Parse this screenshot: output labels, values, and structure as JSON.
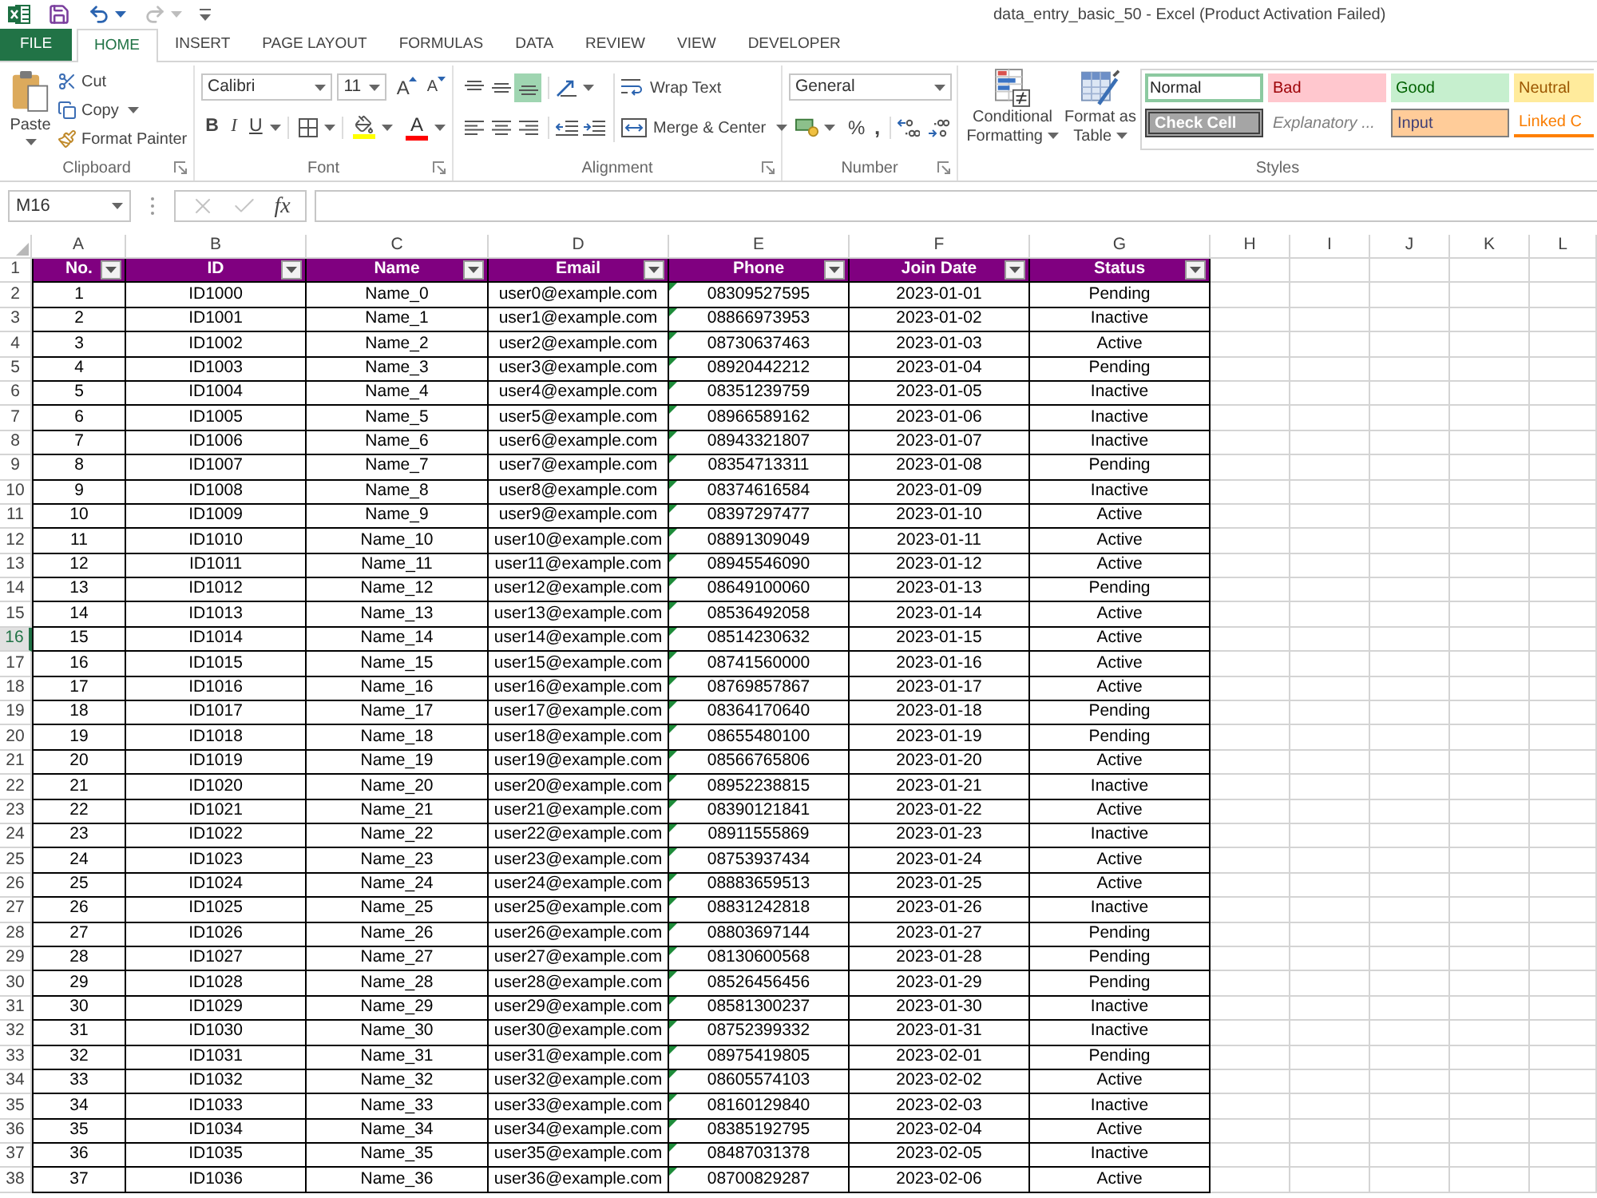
{
  "window": {
    "title": "data_entry_basic_50 - Excel (Product Activation Failed)"
  },
  "quick_access": [
    {
      "kind": "save",
      "disabled": false
    },
    {
      "kind": "undo",
      "disabled": false
    },
    {
      "kind": "redo",
      "disabled": true
    },
    {
      "kind": "customize",
      "disabled": false
    }
  ],
  "tabs": [
    {
      "label": "FILE",
      "kind": "file",
      "selected": false
    },
    {
      "label": "HOME",
      "kind": "tab",
      "selected": true
    },
    {
      "label": "INSERT",
      "kind": "tab",
      "selected": false
    },
    {
      "label": "PAGE LAYOUT",
      "kind": "tab",
      "selected": false
    },
    {
      "label": "FORMULAS",
      "kind": "tab",
      "selected": false
    },
    {
      "label": "DATA",
      "kind": "tab",
      "selected": false
    },
    {
      "label": "REVIEW",
      "kind": "tab",
      "selected": false
    },
    {
      "label": "VIEW",
      "kind": "tab",
      "selected": false
    },
    {
      "label": "DEVELOPER",
      "kind": "tab",
      "selected": false
    }
  ],
  "ribbon": {
    "clipboard": {
      "label": "Clipboard",
      "launcher": true,
      "paste": "Paste",
      "items": [
        {
          "label": "Cut",
          "kind": "cut",
          "dropdown": false
        },
        {
          "label": "Copy",
          "kind": "copy",
          "dropdown": true
        },
        {
          "label": "Format Painter",
          "kind": "painter",
          "dropdown": false
        }
      ]
    },
    "font": {
      "label": "Font",
      "launcher": true,
      "name": "Calibri",
      "size": "11",
      "grow": "A",
      "shrink": "A",
      "styles": [
        {
          "label": "B",
          "kind": "bold",
          "dropdown": false
        },
        {
          "label": "I",
          "kind": "italic",
          "dropdown": false
        },
        {
          "label": "U",
          "kind": "underline",
          "dropdown": true
        }
      ],
      "font_color": "A"
    },
    "alignment": {
      "label": "Alignment",
      "launcher": true,
      "vertical": [
        {
          "kind": "top",
          "selected": false
        },
        {
          "kind": "middle",
          "selected": false
        },
        {
          "kind": "bottom",
          "selected": true
        }
      ],
      "wrap_text": "Wrap Text",
      "merge": "Merge & Center"
    },
    "number": {
      "label": "Number",
      "launcher": true,
      "format": "General",
      "percent": "%",
      "comma": ","
    },
    "styles": {
      "label": "Styles",
      "launcher": false,
      "conditional": "Conditional Formatting",
      "format_table": "Format as Table",
      "gallery": [
        {
          "label": "Normal",
          "kind": "normal",
          "selected": true
        },
        {
          "label": "Bad",
          "kind": "bad",
          "selected": false
        },
        {
          "label": "Good",
          "kind": "good",
          "selected": false
        },
        {
          "label": "Neutral",
          "kind": "neutral",
          "selected": false
        },
        {
          "label": "Check Cell",
          "kind": "check",
          "selected": false
        },
        {
          "label": "Explanatory ...",
          "kind": "explanatory",
          "selected": false
        },
        {
          "label": "Input",
          "kind": "input",
          "selected": false
        },
        {
          "label": "Linked C",
          "kind": "linked",
          "selected": false
        }
      ]
    }
  },
  "formula_bar": {
    "name_box": "M16",
    "function": "fx",
    "buttons_disabled": true
  },
  "sheet": {
    "column_letters": [
      "A",
      "B",
      "C",
      "D",
      "E",
      "F",
      "G",
      "H",
      "I",
      "J",
      "K",
      "L"
    ],
    "row_numbers": [
      {
        "label": "1",
        "selected": false
      },
      {
        "label": "2",
        "selected": false
      },
      {
        "label": "3",
        "selected": false
      },
      {
        "label": "4",
        "selected": false
      },
      {
        "label": "5",
        "selected": false
      },
      {
        "label": "6",
        "selected": false
      },
      {
        "label": "7",
        "selected": false
      },
      {
        "label": "8",
        "selected": false
      },
      {
        "label": "9",
        "selected": false
      },
      {
        "label": "10",
        "selected": false
      },
      {
        "label": "11",
        "selected": false
      },
      {
        "label": "12",
        "selected": false
      },
      {
        "label": "13",
        "selected": false
      },
      {
        "label": "14",
        "selected": false
      },
      {
        "label": "15",
        "selected": false
      },
      {
        "label": "16",
        "selected": true
      },
      {
        "label": "17",
        "selected": false
      },
      {
        "label": "18",
        "selected": false
      },
      {
        "label": "19",
        "selected": false
      },
      {
        "label": "20",
        "selected": false
      },
      {
        "label": "21",
        "selected": false
      },
      {
        "label": "22",
        "selected": false
      },
      {
        "label": "23",
        "selected": false
      },
      {
        "label": "24",
        "selected": false
      },
      {
        "label": "25",
        "selected": false
      },
      {
        "label": "26",
        "selected": false
      },
      {
        "label": "27",
        "selected": false
      },
      {
        "label": "28",
        "selected": false
      },
      {
        "label": "29",
        "selected": false
      },
      {
        "label": "30",
        "selected": false
      },
      {
        "label": "31",
        "selected": false
      },
      {
        "label": "32",
        "selected": false
      },
      {
        "label": "33",
        "selected": false
      },
      {
        "label": "34",
        "selected": false
      },
      {
        "label": "35",
        "selected": false
      },
      {
        "label": "36",
        "selected": false
      },
      {
        "label": "37",
        "selected": false
      },
      {
        "label": "38",
        "selected": false
      }
    ],
    "header": [
      {
        "label": "No.",
        "filter": true,
        "error_marker": false
      },
      {
        "label": "ID",
        "filter": true,
        "error_marker": false
      },
      {
        "label": "Name",
        "filter": true,
        "error_marker": false
      },
      {
        "label": "Email",
        "filter": true,
        "error_marker": false
      },
      {
        "label": "Phone",
        "filter": true,
        "error_marker": true
      },
      {
        "label": "Join Date",
        "filter": true,
        "error_marker": false
      },
      {
        "label": "Status",
        "filter": true,
        "error_marker": false
      }
    ],
    "rows": [
      [
        "1",
        "ID1000",
        "Name_0",
        "user0@example.com",
        "08309527595",
        "2023-01-01",
        "Pending"
      ],
      [
        "2",
        "ID1001",
        "Name_1",
        "user1@example.com",
        "08866973953",
        "2023-01-02",
        "Inactive"
      ],
      [
        "3",
        "ID1002",
        "Name_2",
        "user2@example.com",
        "08730637463",
        "2023-01-03",
        "Active"
      ],
      [
        "4",
        "ID1003",
        "Name_3",
        "user3@example.com",
        "08920442212",
        "2023-01-04",
        "Pending"
      ],
      [
        "5",
        "ID1004",
        "Name_4",
        "user4@example.com",
        "08351239759",
        "2023-01-05",
        "Inactive"
      ],
      [
        "6",
        "ID1005",
        "Name_5",
        "user5@example.com",
        "08966589162",
        "2023-01-06",
        "Inactive"
      ],
      [
        "7",
        "ID1006",
        "Name_6",
        "user6@example.com",
        "08943321807",
        "2023-01-07",
        "Inactive"
      ],
      [
        "8",
        "ID1007",
        "Name_7",
        "user7@example.com",
        "08354713311",
        "2023-01-08",
        "Pending"
      ],
      [
        "9",
        "ID1008",
        "Name_8",
        "user8@example.com",
        "08374616584",
        "2023-01-09",
        "Inactive"
      ],
      [
        "10",
        "ID1009",
        "Name_9",
        "user9@example.com",
        "08397297477",
        "2023-01-10",
        "Active"
      ],
      [
        "11",
        "ID1010",
        "Name_10",
        "user10@example.com",
        "08891309049",
        "2023-01-11",
        "Active"
      ],
      [
        "12",
        "ID1011",
        "Name_11",
        "user11@example.com",
        "08945546090",
        "2023-01-12",
        "Active"
      ],
      [
        "13",
        "ID1012",
        "Name_12",
        "user12@example.com",
        "08649100060",
        "2023-01-13",
        "Pending"
      ],
      [
        "14",
        "ID1013",
        "Name_13",
        "user13@example.com",
        "08536492058",
        "2023-01-14",
        "Active"
      ],
      [
        "15",
        "ID1014",
        "Name_14",
        "user14@example.com",
        "08514230632",
        "2023-01-15",
        "Active"
      ],
      [
        "16",
        "ID1015",
        "Name_15",
        "user15@example.com",
        "08741560000",
        "2023-01-16",
        "Active"
      ],
      [
        "17",
        "ID1016",
        "Name_16",
        "user16@example.com",
        "08769857867",
        "2023-01-17",
        "Active"
      ],
      [
        "18",
        "ID1017",
        "Name_17",
        "user17@example.com",
        "08364170640",
        "2023-01-18",
        "Pending"
      ],
      [
        "19",
        "ID1018",
        "Name_18",
        "user18@example.com",
        "08655480100",
        "2023-01-19",
        "Pending"
      ],
      [
        "20",
        "ID1019",
        "Name_19",
        "user19@example.com",
        "08566765806",
        "2023-01-20",
        "Active"
      ],
      [
        "21",
        "ID1020",
        "Name_20",
        "user20@example.com",
        "08952238815",
        "2023-01-21",
        "Inactive"
      ],
      [
        "22",
        "ID1021",
        "Name_21",
        "user21@example.com",
        "08390121841",
        "2023-01-22",
        "Active"
      ],
      [
        "23",
        "ID1022",
        "Name_22",
        "user22@example.com",
        "08911555869",
        "2023-01-23",
        "Inactive"
      ],
      [
        "24",
        "ID1023",
        "Name_23",
        "user23@example.com",
        "08753937434",
        "2023-01-24",
        "Active"
      ],
      [
        "25",
        "ID1024",
        "Name_24",
        "user24@example.com",
        "08883659513",
        "2023-01-25",
        "Active"
      ],
      [
        "26",
        "ID1025",
        "Name_25",
        "user25@example.com",
        "08831242818",
        "2023-01-26",
        "Inactive"
      ],
      [
        "27",
        "ID1026",
        "Name_26",
        "user26@example.com",
        "08803697144",
        "2023-01-27",
        "Pending"
      ],
      [
        "28",
        "ID1027",
        "Name_27",
        "user27@example.com",
        "08130600568",
        "2023-01-28",
        "Pending"
      ],
      [
        "29",
        "ID1028",
        "Name_28",
        "user28@example.com",
        "08526456456",
        "2023-01-29",
        "Pending"
      ],
      [
        "30",
        "ID1029",
        "Name_29",
        "user29@example.com",
        "08581300237",
        "2023-01-30",
        "Inactive"
      ],
      [
        "31",
        "ID1030",
        "Name_30",
        "user30@example.com",
        "08752399332",
        "2023-01-31",
        "Inactive"
      ],
      [
        "32",
        "ID1031",
        "Name_31",
        "user31@example.com",
        "08975419805",
        "2023-02-01",
        "Pending"
      ],
      [
        "33",
        "ID1032",
        "Name_32",
        "user32@example.com",
        "08605574103",
        "2023-02-02",
        "Active"
      ],
      [
        "34",
        "ID1033",
        "Name_33",
        "user33@example.com",
        "08160129840",
        "2023-02-03",
        "Inactive"
      ],
      [
        "35",
        "ID1034",
        "Name_34",
        "user34@example.com",
        "08385192795",
        "2023-02-04",
        "Active"
      ],
      [
        "36",
        "ID1035",
        "Name_35",
        "user35@example.com",
        "08487031378",
        "2023-02-05",
        "Inactive"
      ],
      [
        "37",
        "ID1036",
        "Name_36",
        "user36@example.com",
        "08700829287",
        "2023-02-06",
        "Active"
      ]
    ]
  }
}
